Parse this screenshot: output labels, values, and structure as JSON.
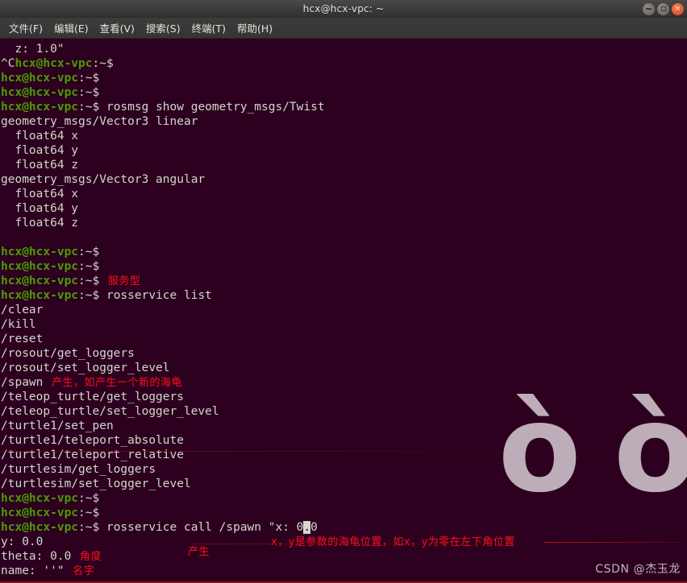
{
  "window": {
    "title": "hcx@hcx-vpc: ~",
    "buttons": {
      "minimize": "minimize",
      "maximize": "maximize",
      "close": "×"
    }
  },
  "menubar": {
    "items": [
      {
        "label": "文件(F)"
      },
      {
        "label": "编辑(E)"
      },
      {
        "label": "查看(V)"
      },
      {
        "label": "搜索(S)"
      },
      {
        "label": "终端(T)"
      },
      {
        "label": "帮助(H)"
      }
    ]
  },
  "terminal": {
    "prompt_user": "hcx@hcx-vpc",
    "prompt_tail": ":~$",
    "lines": [
      {
        "type": "output",
        "text": "  z: 1.0\""
      },
      {
        "type": "prompt",
        "prefix": "^C",
        "cmd": ""
      },
      {
        "type": "prompt",
        "cmd": ""
      },
      {
        "type": "prompt",
        "cmd": ""
      },
      {
        "type": "prompt",
        "cmd": " rosmsg show geometry_msgs/Twist"
      },
      {
        "type": "output",
        "text": "geometry_msgs/Vector3 linear"
      },
      {
        "type": "output",
        "text": "  float64 x"
      },
      {
        "type": "output",
        "text": "  float64 y"
      },
      {
        "type": "output",
        "text": "  float64 z"
      },
      {
        "type": "output",
        "text": "geometry_msgs/Vector3 angular"
      },
      {
        "type": "output",
        "text": "  float64 x"
      },
      {
        "type": "output",
        "text": "  float64 y"
      },
      {
        "type": "output",
        "text": "  float64 z"
      },
      {
        "type": "output",
        "text": ""
      },
      {
        "type": "prompt",
        "cmd": ""
      },
      {
        "type": "prompt",
        "cmd": ""
      },
      {
        "type": "prompt",
        "cmd": "",
        "annot": "服务型"
      },
      {
        "type": "prompt",
        "cmd": " rosservice list"
      },
      {
        "type": "output",
        "text": "/clear"
      },
      {
        "type": "output",
        "text": "/kill"
      },
      {
        "type": "output",
        "text": "/reset"
      },
      {
        "type": "output",
        "text": "/rosout/get_loggers"
      },
      {
        "type": "output",
        "text": "/rosout/set_logger_level"
      },
      {
        "type": "output",
        "text": "/spawn",
        "annot": "产生，如产生一个新的海龟"
      },
      {
        "type": "output",
        "text": "/teleop_turtle/get_loggers"
      },
      {
        "type": "output",
        "text": "/teleop_turtle/set_logger_level"
      },
      {
        "type": "output",
        "text": "/turtle1/set_pen"
      },
      {
        "type": "output",
        "text": "/turtle1/teleport_absolute"
      },
      {
        "type": "output",
        "text": "/turtle1/teleport_relative"
      },
      {
        "type": "output",
        "text": "/turtlesim/get_loggers"
      },
      {
        "type": "output",
        "text": "/turtlesim/set_logger_level"
      },
      {
        "type": "prompt",
        "cmd": ""
      },
      {
        "type": "prompt",
        "cmd": ""
      },
      {
        "type": "cmdcursor",
        "pre": " rosservice call /spawn \"x: 0",
        "cursor": ".",
        "post": "0"
      },
      {
        "type": "output",
        "text": "y: 0.0"
      },
      {
        "type": "output",
        "text": "theta: 0.0",
        "annot": "角度"
      },
      {
        "type": "output",
        "text": "name: ''\"",
        "annot": "名字"
      }
    ],
    "annotations": {
      "service_type": "服务型",
      "spawn_note": "产生，如产生一个新的海龟",
      "generate": "产生",
      "xy_note": "x，y是参数的海龟位置，如x，y为零在左下角位置",
      "theta": "角度",
      "name": "名字"
    }
  },
  "watermark": {
    "glyphs": "ò\nò",
    "text": "CSDN @杰玉龙"
  },
  "colors": {
    "terminal_bg": "#2c001e",
    "prompt_green": "#4e9a06",
    "text_fg": "#d3d7cf",
    "annotation_red": "#e81123",
    "titlebar": "#3c3b39",
    "close_button": "#d6452a"
  }
}
